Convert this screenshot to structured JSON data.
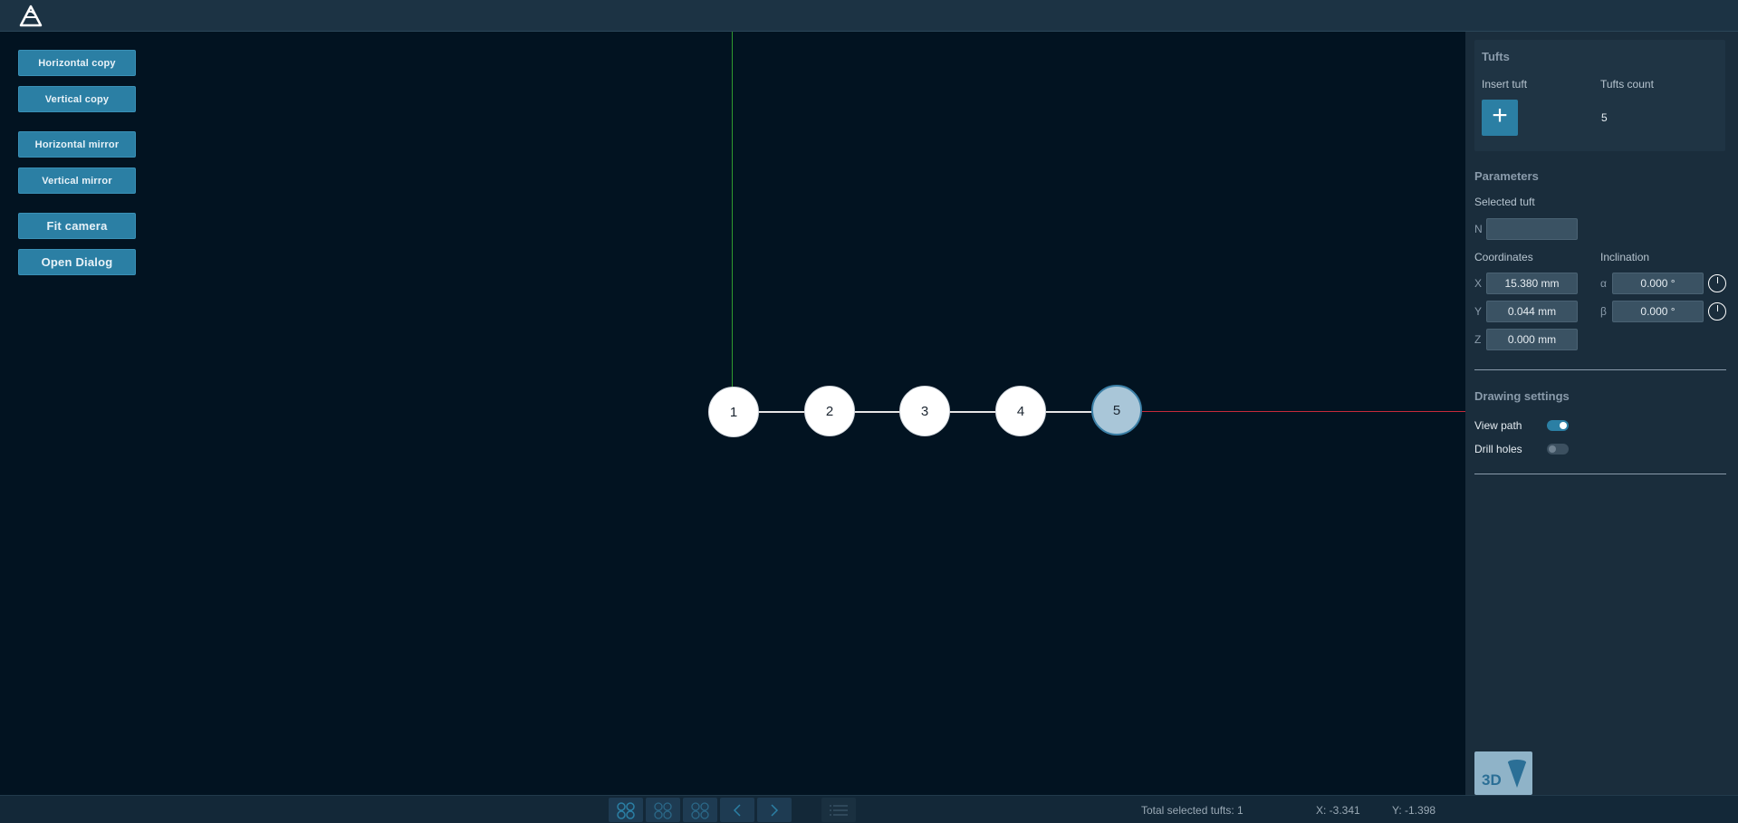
{
  "tools": {
    "horizontal_copy": "Horizontal copy",
    "vertical_copy": "Vertical copy",
    "horizontal_mirror": "Horizontal mirror",
    "vertical_mirror": "Vertical mirror",
    "fit_camera": "Fit camera",
    "open_dialog": "Open Dialog"
  },
  "tufts_viewport": {
    "tufts": [
      "1",
      "2",
      "3",
      "4",
      "5"
    ],
    "selected": "5"
  },
  "panel": {
    "tufts_title": "Tufts",
    "insert_tuft_label": "Insert tuft",
    "insert_icon": "+",
    "tufts_count_label": "Tufts count",
    "tufts_count_value": "5",
    "parameters_title": "Parameters",
    "selected_tuft_label": "Selected tuft",
    "n_label": "N",
    "n_value": "",
    "coordinates_label": "Coordinates",
    "inclination_label": "Inclination",
    "x_label": "X",
    "x_value": "15.380 mm",
    "y_label": "Y",
    "y_value": "0.044 mm",
    "z_label": "Z",
    "z_value": "0.000 mm",
    "alpha_label": "α",
    "alpha_value": "0.000 °",
    "beta_label": "β",
    "beta_value": "0.000 °",
    "drawing_settings_title": "Drawing settings",
    "view_path_label": "View path",
    "view_path_on": true,
    "drill_holes_label": "Drill holes",
    "drill_holes_on": false,
    "view_3d_label": "3D"
  },
  "statusbar": {
    "total_selected": "Total selected tufts: 1",
    "x_readout": "X: -3.341",
    "y_readout": "Y: -1.398"
  },
  "colors": {
    "accent": "#2b7fa4",
    "background": "#021321",
    "axis_x": "#c62a3a",
    "axis_y": "#2f9a2f"
  }
}
